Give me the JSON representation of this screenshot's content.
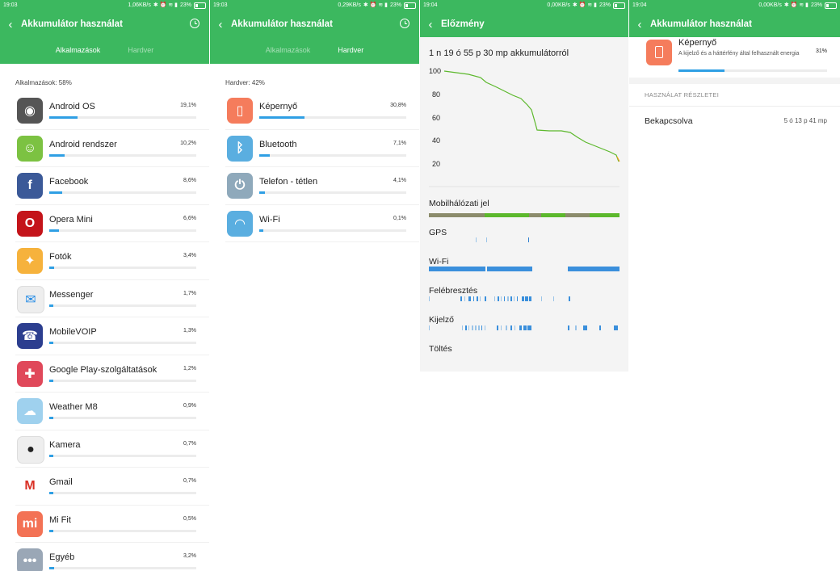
{
  "panel1": {
    "status": {
      "time": "19:03",
      "speed": "1,06KB/s",
      "battery": "23%"
    },
    "title": "Akkumulátor használat",
    "tabs": [
      "Alkalmazások",
      "Hardver"
    ],
    "section": "Alkalmazások: 58%",
    "items": [
      {
        "name": "Android OS",
        "pct": "19,1%",
        "value": 19.1,
        "icon": "android-os-icon",
        "color": "#555555"
      },
      {
        "name": "Android rendszer",
        "pct": "10,2%",
        "value": 10.2,
        "icon": "android-robot-icon",
        "color": "#7cc242"
      },
      {
        "name": "Facebook",
        "pct": "8,6%",
        "value": 8.6,
        "icon": "facebook-icon",
        "color": "#3b5998"
      },
      {
        "name": "Opera Mini",
        "pct": "6,6%",
        "value": 6.6,
        "icon": "opera-mini-icon",
        "color": "#c4141a"
      },
      {
        "name": "Fotók",
        "pct": "3,4%",
        "value": 3.4,
        "icon": "photos-icon",
        "color": "#f6b23c"
      },
      {
        "name": "Messenger",
        "pct": "1,7%",
        "value": 1.7,
        "icon": "messenger-icon",
        "color": "#eeeeee"
      },
      {
        "name": "MobileVOIP",
        "pct": "1,3%",
        "value": 1.3,
        "icon": "mobilevoip-icon",
        "color": "#2c3e8f"
      },
      {
        "name": "Google Play-szolgáltatások",
        "pct": "1,2%",
        "value": 1.2,
        "icon": "puzzle-icon",
        "color": "#e0485a"
      },
      {
        "name": "Weather M8",
        "pct": "0,9%",
        "value": 0.9,
        "icon": "weather-icon",
        "color": "#9fd1ee"
      },
      {
        "name": "Kamera",
        "pct": "0,7%",
        "value": 0.7,
        "icon": "camera-icon",
        "color": "#eeeeee"
      },
      {
        "name": "Gmail",
        "pct": "0,7%",
        "value": 0.7,
        "icon": "gmail-icon",
        "color": "#ffffff"
      },
      {
        "name": "Mi Fit",
        "pct": "0,5%",
        "value": 0.5,
        "icon": "mi-fit-icon",
        "color": "#f37255"
      },
      {
        "name": "Egyéb",
        "pct": "3,2%",
        "value": 3.2,
        "icon": "more-icon",
        "color": "#9aa7b6"
      }
    ]
  },
  "panel2": {
    "status": {
      "time": "19:03",
      "speed": "0,29KB/s",
      "battery": "23%"
    },
    "title": "Akkumulátor használat",
    "tabs": [
      "Alkalmazások",
      "Hardver"
    ],
    "section": "Hardver: 42%",
    "items": [
      {
        "name": "Képernyő",
        "pct": "30,8%",
        "value": 30.8,
        "icon": "screen-icon",
        "color": "#f57c5c"
      },
      {
        "name": "Bluetooth",
        "pct": "7,1%",
        "value": 7.1,
        "icon": "bluetooth-icon",
        "color": "#5aaee0"
      },
      {
        "name": "Telefon - tétlen",
        "pct": "4,1%",
        "value": 4.1,
        "icon": "power-icon",
        "color": "#8fa9bb"
      },
      {
        "name": "Wi-Fi",
        "pct": "0,1%",
        "value": 0.1,
        "icon": "wifi-icon",
        "color": "#5aaee0"
      }
    ]
  },
  "panel3": {
    "status": {
      "time": "19:04",
      "speed": "0,00KB/s",
      "battery": "23%"
    },
    "title": "Előzmény",
    "duration": "1 n 19 ó 55 p 30 mp akkumulátorról",
    "yticks": [
      "100",
      "80",
      "60",
      "40",
      "20"
    ],
    "rows": [
      "Mobilhálózati jel",
      "GPS",
      "Wi-Fi",
      "Felébresztés",
      "Kijelző",
      "Töltés"
    ],
    "line_color": "#5cb82c"
  },
  "panel4": {
    "status": {
      "time": "19:04",
      "speed": "0,00KB/s",
      "battery": "23%"
    },
    "title": "Akkumulátor használat",
    "item": {
      "name": "Képernyő",
      "desc": "A kijelző és a háttérfény által felhasznált energia",
      "pct": "31%",
      "value": 31
    },
    "details_header": "HASZNÁLAT RÉSZLETEI",
    "details": [
      {
        "key": "Bekapcsolva",
        "value": "5 ó 13 p 41 mp"
      }
    ]
  }
}
